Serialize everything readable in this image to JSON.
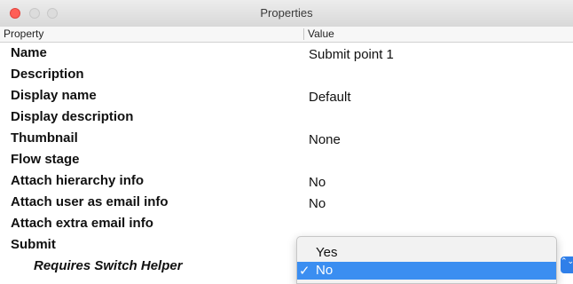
{
  "window": {
    "title": "Properties"
  },
  "table": {
    "headers": {
      "property": "Property",
      "value": "Value"
    },
    "rows": [
      {
        "name": "Name",
        "value": "Submit point 1"
      },
      {
        "name": "Description",
        "value": ""
      },
      {
        "name": "Display name",
        "value": "Default"
      },
      {
        "name": "Display description",
        "value": ""
      },
      {
        "name": "Thumbnail",
        "value": "None"
      },
      {
        "name": "Flow stage",
        "value": ""
      },
      {
        "name": "Attach hierarchy info",
        "value": "No"
      },
      {
        "name": "Attach user as email info",
        "value": "No"
      },
      {
        "name": "Attach extra email info",
        "value": ""
      },
      {
        "name": "Submit",
        "value": ""
      },
      {
        "name": "Requires Switch Helper",
        "value": ""
      }
    ]
  },
  "dropdown": {
    "options": [
      {
        "label": "Yes",
        "selected": false
      },
      {
        "label": "No",
        "selected": true
      }
    ],
    "check_glyph": "✓",
    "stepper_glyph": "⌃⌄",
    "selected_color": "#3b8ef1"
  }
}
